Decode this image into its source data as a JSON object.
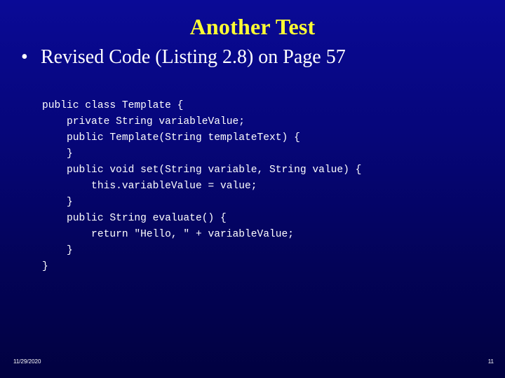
{
  "slide": {
    "title": "Another Test",
    "bullet_symbol": "•",
    "bullet_text": "Revised Code (Listing 2.8) on Page 57",
    "code_lines": [
      "public class Template {",
      "    private String variableValue;",
      "    public Template(String templateText) {",
      "    }",
      "    public void set(String variable, String value) {",
      "        this.variableValue = value;",
      "    }",
      "    public String evaluate() {",
      "        return \"Hello, \" + variableValue;",
      "    }",
      "}"
    ],
    "footer_date": "11/29/2020",
    "page_number": "11"
  },
  "colors": {
    "title": "#ffff33",
    "text": "#ffffff",
    "background_top": "#0a0a96",
    "background_bottom": "#010140"
  }
}
